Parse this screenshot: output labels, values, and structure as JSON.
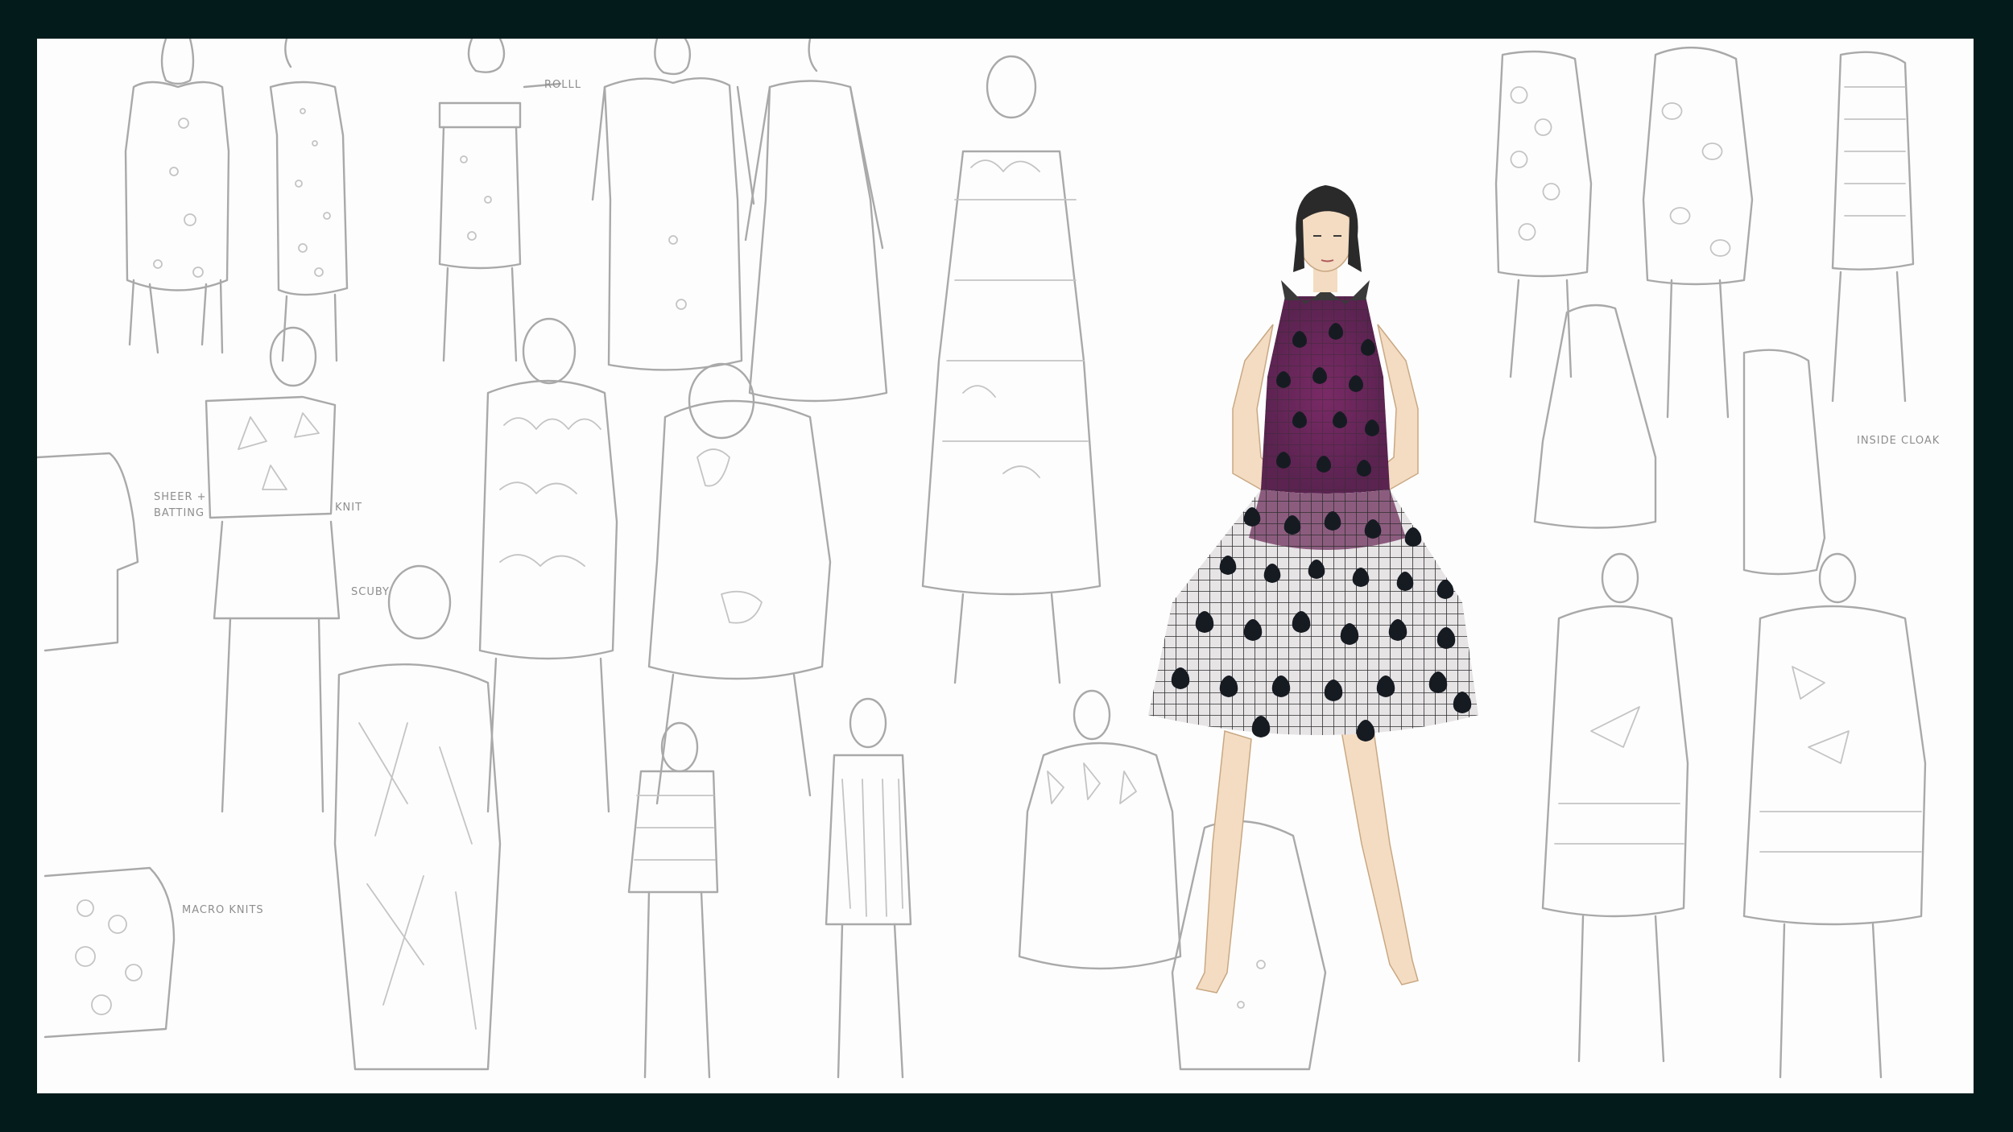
{
  "image": {
    "kind": "fashion design sketch board",
    "background_frame_color": "#041b1b",
    "paper_color": "#fdfdfd",
    "pencil_color": "#a9a9a9",
    "feature_dress_colors": {
      "skin": "#f3dcc2",
      "hair": "#2a2a2a",
      "dress_black": "#161b22",
      "dress_purple": "#6e2f5c",
      "grid_lines": "#2e2e2e"
    }
  },
  "annotations": {
    "roll": "ROLLL",
    "sheer_batting_1": "SHEER +",
    "sheer_batting_2": "BATTING",
    "knit": "KNIT",
    "scuby": "SCUBY",
    "macro_knits": "MACRO KNITS",
    "inside_cloak": "INSIDE CLOAK"
  }
}
